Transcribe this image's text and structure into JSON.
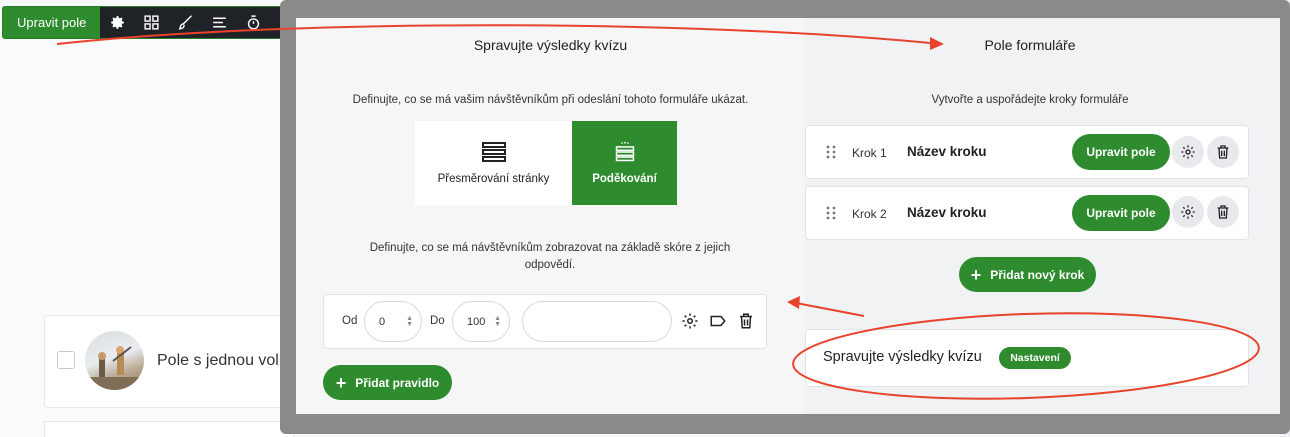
{
  "colors": {
    "accent": "#2e8b2e",
    "annotation": "#e8432d",
    "toolbar": "#1f2327"
  },
  "toolbar": {
    "edit_label": "Upravit pole",
    "icons": [
      "gear-icon",
      "layout-icon",
      "brush-icon",
      "align-icon",
      "timer-icon"
    ]
  },
  "background": {
    "field_label": "Pole s jednou volbou"
  },
  "quiz_results": {
    "title": "Spravujte výsledky kvízu",
    "description": "Definujte, co se má vašim návštěvníkům při odeslání tohoto formuláře ukázat.",
    "options": [
      {
        "label": "Přesměrování stránky",
        "selected": false
      },
      {
        "label": "Poděkování",
        "selected": true
      }
    ],
    "score_description": "Definujte, co se má návštěvníkům zobrazovat na základě skóre z jejich odpovědí.",
    "rule": {
      "from_label": "Od",
      "from_value": "0",
      "to_label": "Do",
      "to_value": "100",
      "text_value": ""
    },
    "add_rule_label": "Přidat pravidlo"
  },
  "form_fields": {
    "title": "Pole formuláře",
    "description": "Vytvořte a uspořádejte kroky formuláře",
    "steps": [
      {
        "number": "Krok 1",
        "name": "Název kroku",
        "edit_label": "Upravit pole"
      },
      {
        "number": "Krok 2",
        "name": "Název kroku",
        "edit_label": "Upravit pole"
      }
    ],
    "add_step_label": "Přidat nový krok",
    "quiz_manage": {
      "label": "Spravujte výsledky kvízu",
      "badge": "Nastavení"
    }
  }
}
